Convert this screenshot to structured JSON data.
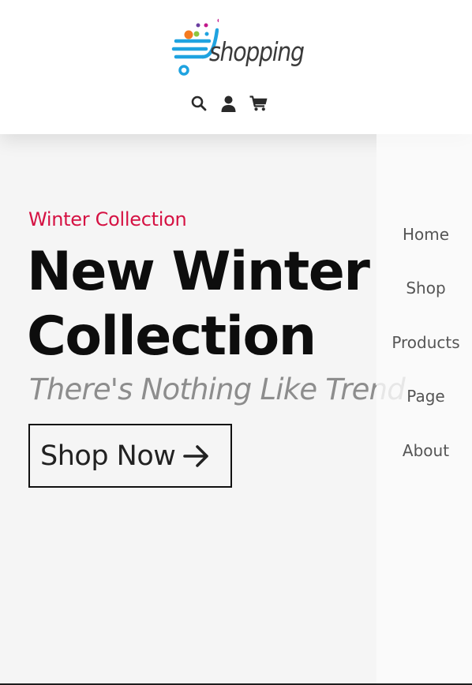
{
  "header": {
    "logo_text": "shopping",
    "icons": [
      "search-icon",
      "user-icon",
      "cart-icon"
    ]
  },
  "hero": {
    "eyebrow": "Winter Collection",
    "headline_line1": "New Winter",
    "headline_line2": "Collection",
    "tagline": "There's Nothing Like Trend",
    "cta_label": "Shop Now",
    "cta_icon": "arrow-right-icon"
  },
  "nav": {
    "items": [
      {
        "label": "Home"
      },
      {
        "label": "Shop"
      },
      {
        "label": "Products"
      },
      {
        "label": "Page"
      },
      {
        "label": "About"
      }
    ]
  },
  "colors": {
    "accent": "#d51243",
    "heading": "#0d0d0d",
    "tagline": "#8d8d8d",
    "hero_bg": "#f5f5f5",
    "logo_blue": "#1fa3e0",
    "logo_orange": "#f47a20",
    "logo_green": "#8cc63f",
    "logo_magenta": "#c2188b"
  }
}
